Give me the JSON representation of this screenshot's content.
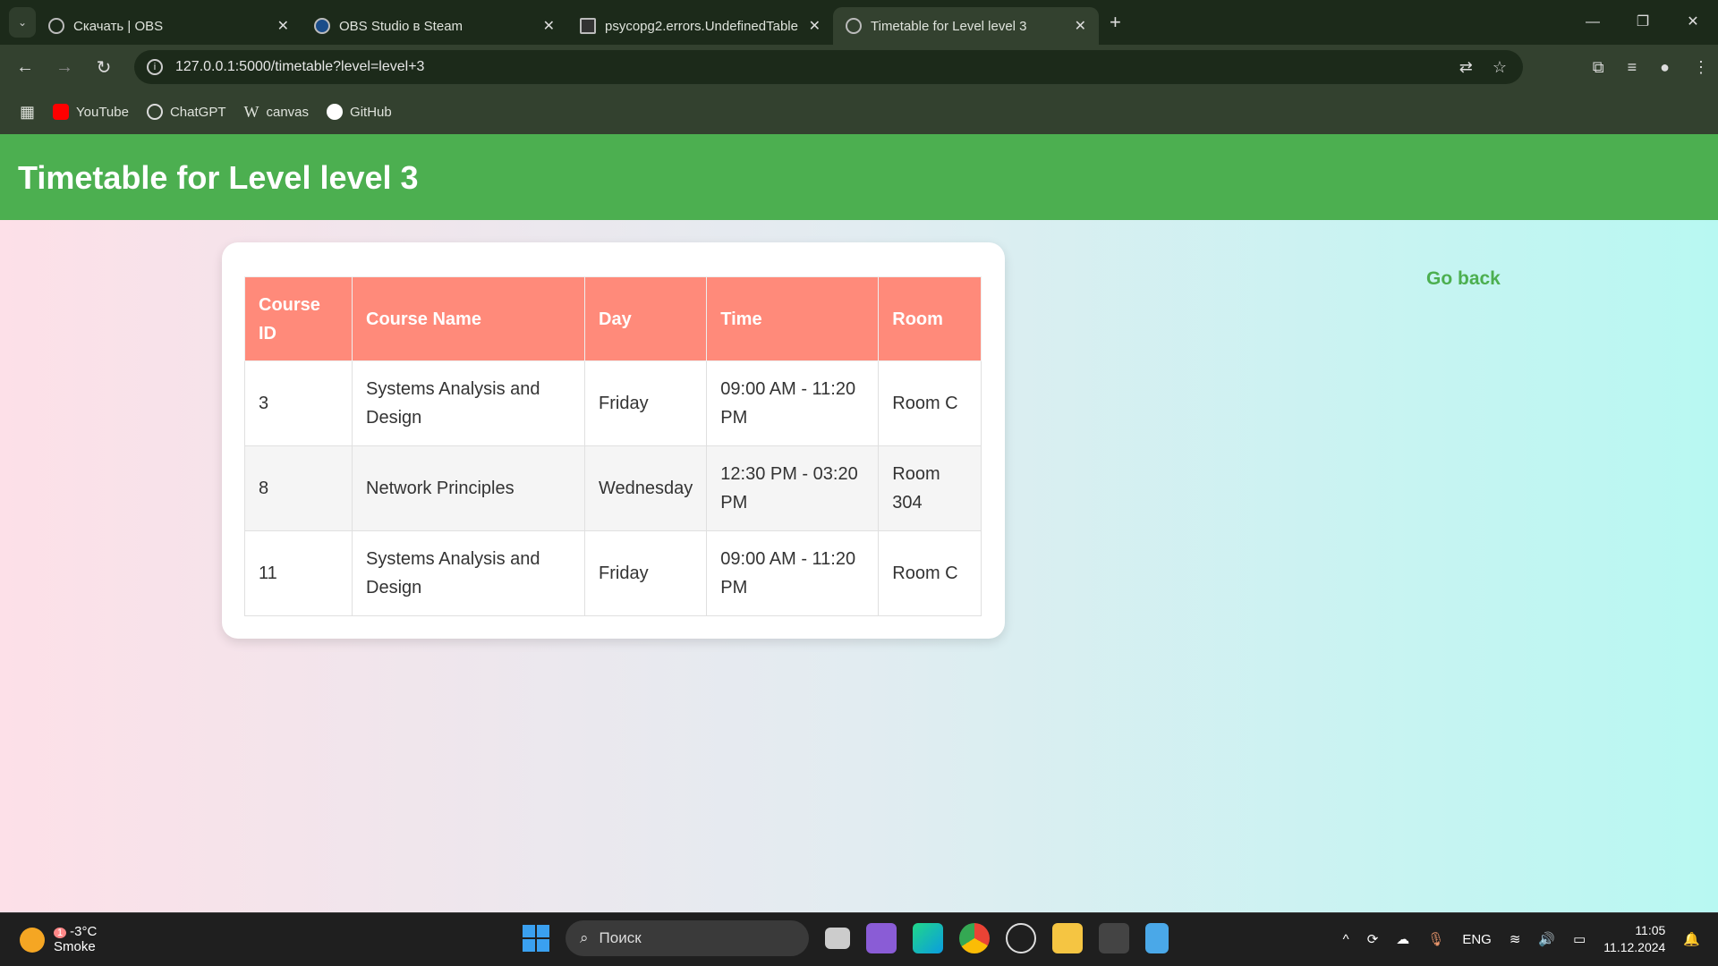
{
  "browser": {
    "tabs": [
      {
        "title": "Скачать | OBS",
        "active": false
      },
      {
        "title": "OBS Studio в Steam",
        "active": false
      },
      {
        "title": "psycopg2.errors.UndefinedTable",
        "active": false
      },
      {
        "title": "Timetable for Level level 3",
        "active": true
      }
    ],
    "url": "127.0.0.1:5000/timetable?level=level+3",
    "bookmarks": [
      {
        "label": "YouTube",
        "color": "#ff0000"
      },
      {
        "label": "ChatGPT",
        "color": "#000000"
      },
      {
        "label": "canvas",
        "color": "#1f3b7a"
      },
      {
        "label": "GitHub",
        "color": "#ffffff"
      }
    ]
  },
  "page": {
    "title": "Timetable for Level level 3",
    "go_back": "Go back",
    "table": {
      "headers": [
        "Course ID",
        "Course Name",
        "Day",
        "Time",
        "Room"
      ],
      "rows": [
        [
          "3",
          "Systems Analysis and Design",
          "Friday",
          "09:00 AM - 11:20 PM",
          "Room C"
        ],
        [
          "8",
          "Network Principles",
          "Wednesday",
          "12:30 PM - 03:20 PM",
          "Room 304"
        ],
        [
          "11",
          "Systems Analysis and Design",
          "Friday",
          "09:00 AM - 11:20 PM",
          "Room C"
        ]
      ]
    }
  },
  "taskbar": {
    "weather": {
      "temp": "-3°C",
      "condition": "Smoke",
      "badge": "1"
    },
    "search_placeholder": "Поиск",
    "language": "ENG",
    "time": "11:05",
    "date": "11.12.2024"
  }
}
